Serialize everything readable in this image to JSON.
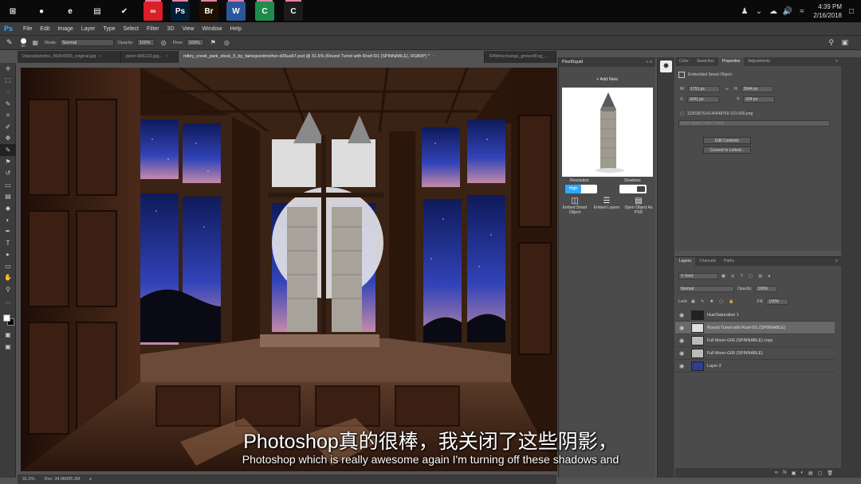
{
  "taskbar": {
    "apps": [
      {
        "name": "windows-start",
        "glyph": "⊞",
        "color": "#0a0a0a"
      },
      {
        "name": "chrome",
        "glyph": "●",
        "color": "#0a0a0a"
      },
      {
        "name": "edge",
        "glyph": "e",
        "color": "#0a0a0a"
      },
      {
        "name": "file-explorer",
        "glyph": "▤",
        "color": "#0a0a0a"
      },
      {
        "name": "norton",
        "glyph": "✔",
        "color": "#0a0a0a"
      },
      {
        "name": "creative-cloud",
        "glyph": "∞",
        "color": "#da1f26"
      },
      {
        "name": "photoshop",
        "glyph": "Ps",
        "color": "#001e36"
      },
      {
        "name": "bridge",
        "glyph": "Br",
        "color": "#1e1000"
      },
      {
        "name": "word",
        "glyph": "W",
        "color": "#2b579a"
      },
      {
        "name": "camtasia",
        "glyph": "C",
        "color": "#1f8b4c"
      },
      {
        "name": "camtasia-recorder",
        "glyph": "C",
        "color": "#1b1b1b"
      }
    ],
    "clock_time": "4:39 PM",
    "clock_date": "2/16/2018"
  },
  "app_logo": "Ps",
  "menu": [
    "File",
    "Edit",
    "Image",
    "Layer",
    "Type",
    "Select",
    "Filter",
    "3D",
    "View",
    "Window",
    "Help"
  ],
  "options": {
    "brush_size": "80",
    "mode_label": "Mode:",
    "mode_value": "Normal",
    "opacity_label": "Opacity:",
    "opacity_value": "100%",
    "flow_label": "Flow:",
    "flow_value": "100%"
  },
  "tabs": [
    {
      "label": "Depositphotos_49364393_original.jpg",
      "active": false
    },
    {
      "label": "peter-686132.jpg...",
      "active": false
    },
    {
      "label": "ridley_creek_park_stock_5_by_fairiegoodmother-d36ua57.psd @ 31.6% (Round Turret with Roof-I01 (SPINNABLE), RGB/8*) *",
      "active": true
    },
    {
      "label": "RAWexchange_groundFog_...",
      "active": false
    }
  ],
  "status": {
    "zoom": "31.6%",
    "doc": "Doc: 34.9M/95.3M"
  },
  "pixelsquid": {
    "title": "PixelSquid",
    "add_new": "+ Add New",
    "resolution_label": "Resolution",
    "resolution_value": "High",
    "shadows_label": "Shadows",
    "embed_smart": "Embed Smart Object",
    "embed_layers": "Embed Layers",
    "open_psd": "Open Object As PSD"
  },
  "properties": {
    "tabs": [
      {
        "label": "Color",
        "active": false
      },
      {
        "label": "Swatches",
        "active": false
      },
      {
        "label": "Properties",
        "active": true
      },
      {
        "label": "Adjustments",
        "active": false
      }
    ],
    "type": "Embedded Smart Object",
    "w_label": "W:",
    "w_value": "1751 px",
    "h_label": "H:",
    "h_value": "2644 px",
    "x_label": "X:",
    "x_value": "1641 px",
    "y_label": "Y:",
    "y_value": "204 px",
    "filename": "1235367514140448750-101-600.png",
    "layer_comp": "Don't Apply Layer Comp",
    "edit_contents": "Edit Contents",
    "convert_linked": "Convert to Linked..."
  },
  "layers_panel": {
    "tabs": [
      {
        "label": "Layers",
        "active": true
      },
      {
        "label": "Channels",
        "active": false
      },
      {
        "label": "Paths",
        "active": false
      }
    ],
    "kind": "Kind",
    "blend": "Normal",
    "opacity_label": "Opacity:",
    "opacity_value": "100%",
    "lock_label": "Lock:",
    "fill_label": "Fill:",
    "fill_value": "100%",
    "layers": [
      {
        "name": "Hue/Saturation 1",
        "selected": false,
        "thumb": "#222"
      },
      {
        "name": "Round Turret with Roof-I01 (SPINNABLE)",
        "selected": true,
        "thumb": "#ddd"
      },
      {
        "name": "Full Moon-G06 (SPINNABLE) copy",
        "selected": false,
        "thumb": "#bbb"
      },
      {
        "name": "Full Moon-G06 (SPINNABLE)",
        "selected": false,
        "thumb": "#bbb"
      },
      {
        "name": "Layer 2",
        "selected": false,
        "thumb": "#2d3e8a"
      }
    ]
  },
  "subtitles": {
    "zh": "Photoshop真的很棒，我关闭了这些阴影，",
    "en": "Photoshop which is really awesome again I'm turning off these shadows and"
  }
}
